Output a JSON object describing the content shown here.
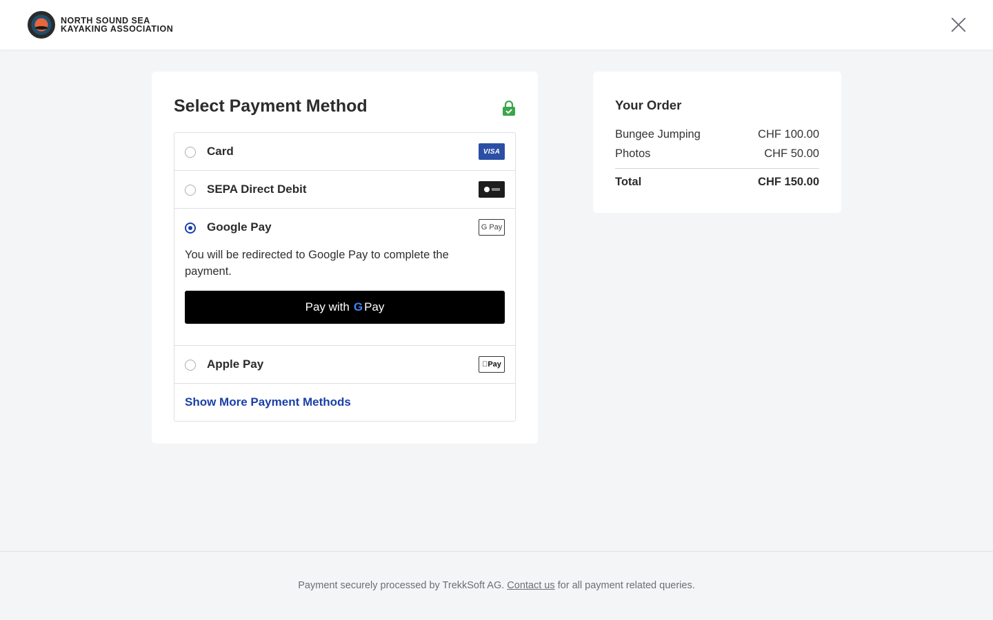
{
  "header": {
    "brand_line1": "NORTH SOUND SEA",
    "brand_line2": "KAYAKING ASSOCIATION",
    "logo_icon": "kayak-association-logo",
    "close_icon": "close-icon"
  },
  "payment": {
    "title": "Select Payment Method",
    "lock_icon": "lock-icon",
    "methods": [
      {
        "label": "Card",
        "badge": "VISA",
        "selected": false
      },
      {
        "label": "SEPA Direct Debit",
        "badge": "sepa-logo",
        "selected": false
      },
      {
        "label": "Google Pay",
        "badge": "G Pay",
        "selected": true,
        "description": "You will be redirected to Google Pay to complete the payment.",
        "button_prefix": "Pay with",
        "button_g": "G",
        "button_suffix": "Pay"
      },
      {
        "label": "Apple Pay",
        "badge": "Pay",
        "selected": false
      }
    ],
    "more_link": "Show More Payment Methods"
  },
  "order": {
    "title": "Your Order",
    "items": [
      {
        "name": "Bungee Jumping",
        "price": "CHF 100.00"
      },
      {
        "name": "Photos",
        "price": "CHF 50.00"
      }
    ],
    "total_label": "Total",
    "total_value": "CHF 150.00"
  },
  "footer": {
    "text_before": "Payment securely processed by TrekkSoft AG.",
    "link": "Contact us",
    "text_after": "for all payment related queries."
  },
  "colors": {
    "accent": "#1a3fa8",
    "lock_green": "#3aa64a",
    "background": "#f4f5f7"
  }
}
